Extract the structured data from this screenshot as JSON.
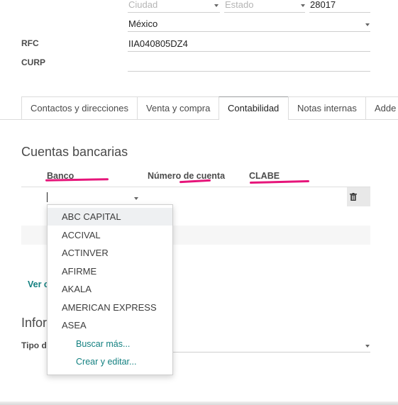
{
  "address": {
    "city_placeholder": "Ciudad",
    "state_placeholder": "Estado",
    "zip": "28017",
    "country": "México"
  },
  "fields": {
    "rfc_label": "RFC",
    "rfc_value": "IIA040805DZ4",
    "curp_label": "CURP",
    "curp_value": ""
  },
  "tabs": [
    {
      "label": "Contactos y direcciones"
    },
    {
      "label": "Venta y compra"
    },
    {
      "label": "Contabilidad"
    },
    {
      "label": "Notas internas"
    },
    {
      "label": "Adde"
    }
  ],
  "active_tab": "Contabilidad",
  "bank_section": {
    "title": "Cuentas bancarias",
    "columns": [
      "Banco",
      "Número de cuenta",
      "CLABE"
    ],
    "more_link_partial": "Ver c",
    "section2_partial": "Infor",
    "tipo_label_partial": "Tipo d"
  },
  "dropdown": {
    "options": [
      "ABC CAPITAL",
      "ACCIVAL",
      "ACTINVER",
      "AFIRME",
      "AKALA",
      "AMERICAN EXPRESS",
      "ASEA"
    ],
    "selected_index": 0,
    "search_more": "Buscar más...",
    "create_edit": "Crear y editar..."
  },
  "colors": {
    "highlight": "#e6157a",
    "link": "#138080"
  }
}
